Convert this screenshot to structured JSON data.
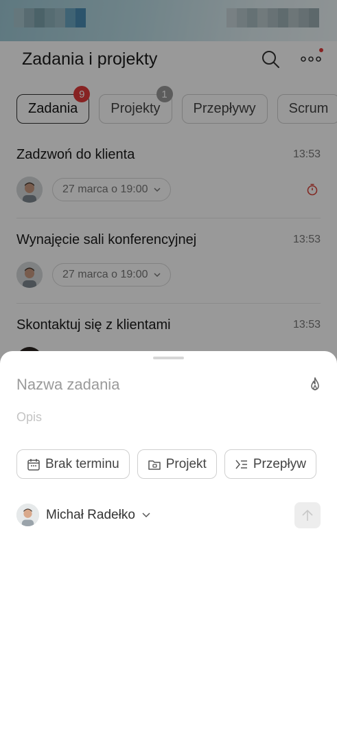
{
  "header": {
    "title": "Zadania i projekty"
  },
  "tabs": [
    {
      "label": "Zadania",
      "badge": "9",
      "active": true
    },
    {
      "label": "Projekty",
      "badge": "1"
    },
    {
      "label": "Przepływy"
    },
    {
      "label": "Scrum"
    }
  ],
  "tasks": [
    {
      "title": "Zadzwoń do klienta",
      "time": "13:53",
      "date": "27 marca o 19:00"
    },
    {
      "title": "Wynajęcie sali konferencyjnej",
      "time": "13:53",
      "date": "27 marca o 19:00"
    },
    {
      "title": "Skontaktuj się z klientami",
      "time": "13:53"
    }
  ],
  "sheet": {
    "name_placeholder": "Nazwa zadania",
    "desc_placeholder": "Opis",
    "chips": {
      "deadline": "Brak terminu",
      "project": "Projekt",
      "flow": "Przepływ"
    },
    "assignee": "Michał Radełko"
  },
  "colors": {
    "badge_red": "#e23b3b",
    "timer_red": "#d9453b",
    "overlay": "rgba(0,0,0,0.4)"
  }
}
